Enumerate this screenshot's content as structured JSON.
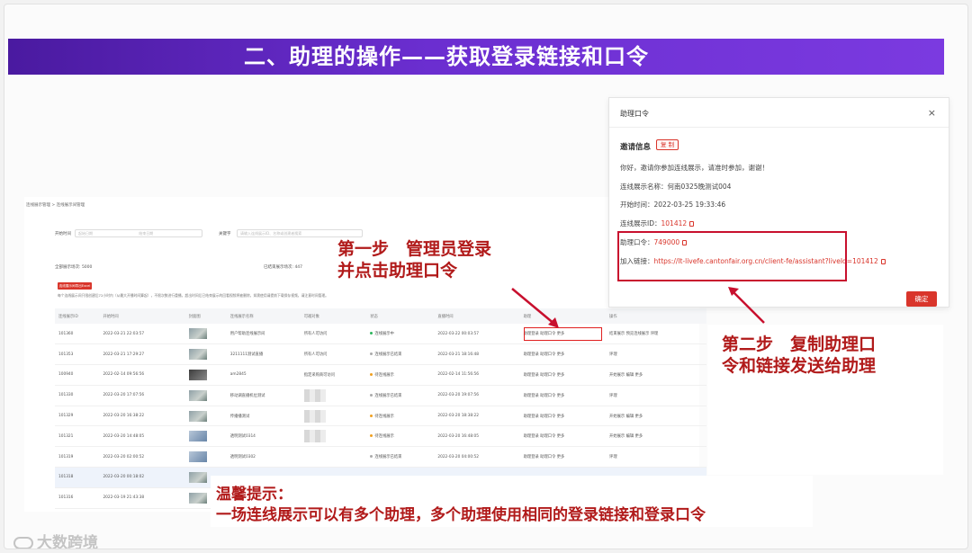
{
  "banner": {
    "title": "二、助理的操作——获取登录链接和口令"
  },
  "admin": {
    "breadcrumb": "连线展示管理 > 连线展示间管理",
    "filters": {
      "start_time_label": "开始时间",
      "date_from_placeholder": "起始日期",
      "date_to_placeholder": "结束日期",
      "keyword_label": "关键字",
      "keyword_placeholder": "请输入连线展示ID、名称或创建者搜索"
    },
    "stats": {
      "total": "全部展示场次: 5000",
      "ended": "已结束展示场次: 447"
    },
    "export_button": "连线展示间导出Excel",
    "notice": "每个连线展示间只限创建后72小时内（从最大开播时间算起），不限次数进行重播，超出时间后已结束展示的回看视频将被删除，如需使用请提前下载保存视频，请注意时间管理。",
    "table": {
      "headers": [
        "连线展示ID",
        "开始时间",
        "封面图",
        "连线展示名称",
        "可邀对象",
        "状态",
        "直播时间",
        "助理",
        "操作"
      ],
      "rows": [
        {
          "id": "101360",
          "start": "2022-03-21 22:03:57",
          "name": "用户帮助连线展示间",
          "invite": "所有人可访问",
          "status": "连线展示中",
          "status_color": "#2db55d",
          "time": "2022-03-22 00:03:57",
          "assist": "助理登录 助理口令 更多",
          "ops": "结束展示 预览连线展示 评理",
          "thumb": "img"
        },
        {
          "id": "101353",
          "start": "2022-03-21 17:29:27",
          "name": "3211111测试直播",
          "invite": "所有人可访问",
          "status": "连线展示已结束",
          "status_color": "#aaaaaa",
          "time": "2022-03-21 18:16:48",
          "assist": "助理登录 助理口令 更多",
          "ops": "评理",
          "thumb": "img"
        },
        {
          "id": "100940",
          "start": "2022-02-14 09:56:56",
          "name": "am2845",
          "invite": "指定采购商可访问",
          "status": "待连线展示",
          "status_color": "#f0a020",
          "time": "2022-02-14 11:56:56",
          "assist": "助理登录 助理口令 更多",
          "ops": "开始展示 编辑 更多",
          "thumb": "dk"
        },
        {
          "id": "101330",
          "start": "2022-03-20 17:07:56",
          "name": "移动调直播机位测试",
          "invite": "",
          "status": "连线展示已结束",
          "status_color": "#aaaaaa",
          "time": "2022-03-20 19:07:56",
          "assist": "助理登录 助理口令 更多",
          "ops": "评理",
          "thumb": "img"
        },
        {
          "id": "101329",
          "start": "2022-03-20 16:38:22",
          "name": "传播播测试",
          "invite": "",
          "status": "待连线展示",
          "status_color": "#f0a020",
          "time": "2022-03-20 18:38:22",
          "assist": "助理登录 助理口令 更多",
          "ops": "开始展示 编辑 更多",
          "thumb": "img"
        },
        {
          "id": "101321",
          "start": "2022-03-20 14:48:05",
          "name": "透明测试0314",
          "invite": "",
          "status": "待连线展示",
          "status_color": "#f0a020",
          "time": "2022-03-20 16:48:05",
          "assist": "助理登录 助理口令 更多",
          "ops": "开始展示 编辑 更多",
          "thumb": "blue"
        },
        {
          "id": "101319",
          "start": "2022-03-20 02:00:52",
          "name": "透明测试0302",
          "invite": "",
          "status": "连线展示已结束",
          "status_color": "#aaaaaa",
          "time": "2022-03-20 04:00:52",
          "assist": "助理登录 助理口令 更多",
          "ops": "评理",
          "thumb": "blue"
        },
        {
          "id": "101318",
          "start": "2022-03-20 00:18:02",
          "name": "",
          "invite": "",
          "status": "",
          "status_color": "#aaaaaa",
          "time": "",
          "assist": "",
          "ops": "",
          "thumb": "img"
        },
        {
          "id": "101316",
          "start": "2022-03-19 21:43:38",
          "name": "",
          "invite": "",
          "status": "",
          "status_color": "#aaaaaa",
          "time": "",
          "assist": "",
          "ops": "",
          "thumb": "img"
        }
      ]
    }
  },
  "step1": {
    "line1": "第一步　管理员登录",
    "line2": "并点击助理口令"
  },
  "step2": {
    "line1": "第二步　复制助理口",
    "line2": "令和链接发送给助理"
  },
  "dialog": {
    "title": "助理口令",
    "close": "×",
    "invite_title": "邀请信息",
    "copy_tag": "复 制",
    "greeting": "你好，邀请你参加连线展示，请准时参加，谢谢！",
    "name_line": "连线展示名称：何南0325晚测试004",
    "start_line": "开始时间：2022-03-25 19:33:46",
    "id_label": "连线展示ID：",
    "id_value": "101412",
    "password_label": "助理口令：",
    "password_value": "749000",
    "link_label": "加入链接：",
    "link_value": "https://lt-livefe.cantonfair.org.cn/client-fe/assistant?liveId=101412",
    "confirm": "确定"
  },
  "tip": {
    "title": "温馨提示：",
    "body": "一场连线展示可以有多个助理，多个助理使用相同的登录链接和登录口令"
  },
  "logo": {
    "text": "大数跨境"
  },
  "colors": {
    "accent": "#d9352b",
    "banner": "#6b2ed0",
    "callout": "#b11a1a"
  }
}
